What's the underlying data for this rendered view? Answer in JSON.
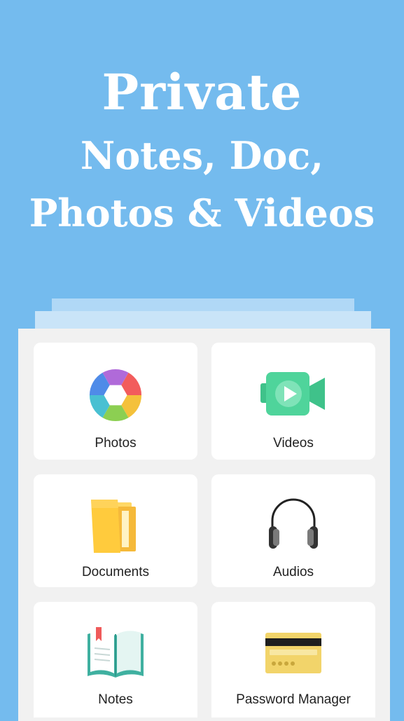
{
  "hero": {
    "line1": "Private",
    "line2": "Notes, Doc,",
    "line3": "Photos & Videos"
  },
  "tiles": [
    {
      "label": "Photos",
      "icon": "aperture-icon"
    },
    {
      "label": "Videos",
      "icon": "video-camera-icon"
    },
    {
      "label": "Documents",
      "icon": "folder-icon"
    },
    {
      "label": "Audios",
      "icon": "headphones-icon"
    },
    {
      "label": "Notes",
      "icon": "open-book-icon"
    },
    {
      "label": "Password Manager",
      "icon": "credit-card-icon"
    }
  ],
  "colors": {
    "background": "#74bbee",
    "panel": "#f1f1f1",
    "tile": "#ffffff"
  }
}
